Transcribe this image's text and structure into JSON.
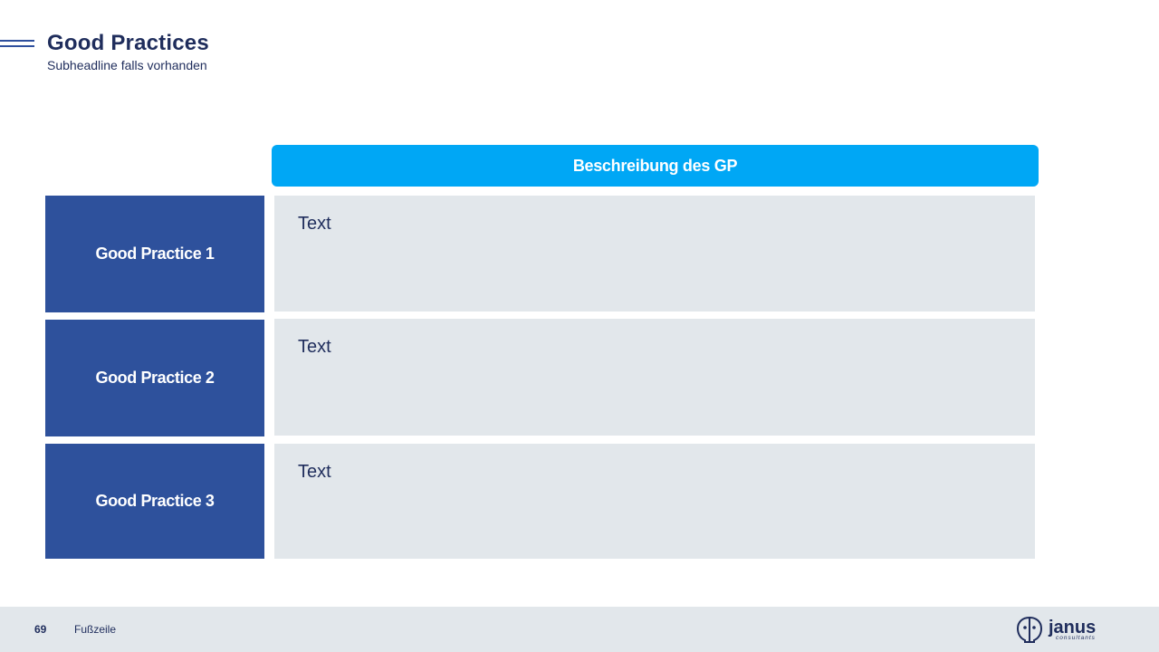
{
  "slide": {
    "title": "Good Practices",
    "subtitle": "Subheadline falls vorhanden"
  },
  "table": {
    "header": "Beschreibung des GP",
    "rows": [
      {
        "label": "Good Practice 1",
        "text": "Text"
      },
      {
        "label": "Good Practice 2",
        "text": "Text"
      },
      {
        "label": "Good Practice 3",
        "text": "Text"
      }
    ]
  },
  "footer": {
    "page_number": "69",
    "text": "Fußzeile",
    "logo_name": "janus",
    "logo_tagline": "consultants"
  },
  "colors": {
    "header_blue": "#00a7f5",
    "label_blue": "#2e519c",
    "cell_gray": "#e2e7eb",
    "text_navy": "#1f2d5c"
  }
}
